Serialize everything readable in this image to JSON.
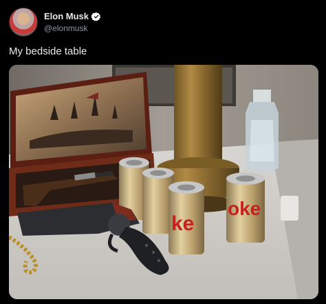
{
  "author": {
    "display_name": "Elon Musk",
    "handle": "@elonmusk",
    "verified": true,
    "avatar_icon": "profile-avatar"
  },
  "tweet": {
    "text": "My bedside table"
  },
  "colors": {
    "background": "#000000",
    "text_primary": "#e7e9ea",
    "text_secondary": "#8b98a5",
    "verified_badge": "#ffffff"
  },
  "photo": {
    "can_text_left": "ke",
    "can_text_right": "oke"
  }
}
